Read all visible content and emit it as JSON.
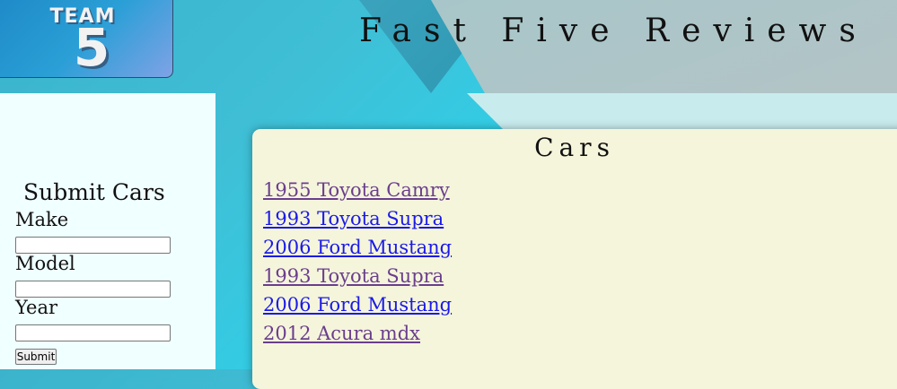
{
  "header": {
    "logo": {
      "team_text": "TEAM",
      "team_number": "5"
    },
    "site_title": "Fast Five Reviews"
  },
  "sidebar": {
    "form_title": "Submit Cars",
    "fields": [
      {
        "label": "Make",
        "value": ""
      },
      {
        "label": "Model",
        "value": ""
      },
      {
        "label": "Year",
        "value": ""
      }
    ],
    "submit_label": "Submit"
  },
  "main": {
    "title": "Cars",
    "cars": [
      {
        "label": "1955 Toyota Camry",
        "visited": true
      },
      {
        "label": "1993 Toyota Supra",
        "visited": false
      },
      {
        "label": "2006 Ford Mustang",
        "visited": false
      },
      {
        "label": "1993 Toyota Supra",
        "visited": true
      },
      {
        "label": "2006 Ford Mustang",
        "visited": false
      },
      {
        "label": "2012 Acura mdx",
        "visited": true
      }
    ]
  },
  "colors": {
    "visited_link": "#6a3e8c",
    "unvisited_link": "#1a1ae8",
    "content_background": "#f5f5dc",
    "sidebar_background": "#f0ffff"
  }
}
